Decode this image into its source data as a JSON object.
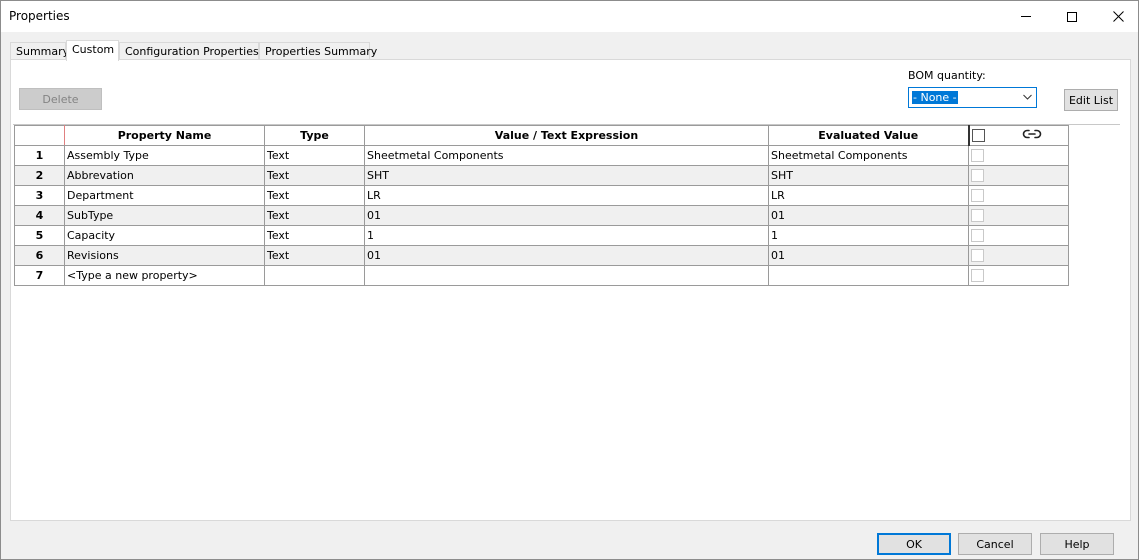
{
  "window": {
    "title": "Properties"
  },
  "tabs": [
    {
      "label": "Summary"
    },
    {
      "label": "Custom"
    },
    {
      "label": "Configuration Properties"
    },
    {
      "label": "Properties Summary"
    }
  ],
  "toolbar": {
    "delete_label": "Delete",
    "bom_label": "BOM quantity:",
    "bom_selected": "- None -",
    "edit_list_label": "Edit List"
  },
  "grid": {
    "headers": [
      "Property Name",
      "Type",
      "Value / Text Expression",
      "Evaluated Value"
    ],
    "rows": [
      {
        "num": "1",
        "name": "Assembly Type",
        "type": "Text",
        "value": "Sheetmetal Components",
        "evaluated": "Sheetmetal Components"
      },
      {
        "num": "2",
        "name": "Abbrevation",
        "type": "Text",
        "value": "SHT",
        "evaluated": "SHT"
      },
      {
        "num": "3",
        "name": "Department",
        "type": "Text",
        "value": "LR",
        "evaluated": "LR"
      },
      {
        "num": "4",
        "name": "SubType",
        "type": "Text",
        "value": "01",
        "evaluated": "01"
      },
      {
        "num": "5",
        "name": "Capacity",
        "type": "Text",
        "value": "1",
        "evaluated": "1"
      },
      {
        "num": "6",
        "name": "Revisions",
        "type": "Text",
        "value": "01",
        "evaluated": "01"
      },
      {
        "num": "7",
        "name": "<Type a new property>",
        "type": "",
        "value": "",
        "evaluated": ""
      }
    ]
  },
  "footer": {
    "ok_label": "OK",
    "cancel_label": "Cancel",
    "help_label": "Help"
  },
  "colors": {
    "accent": "#0078d7"
  }
}
